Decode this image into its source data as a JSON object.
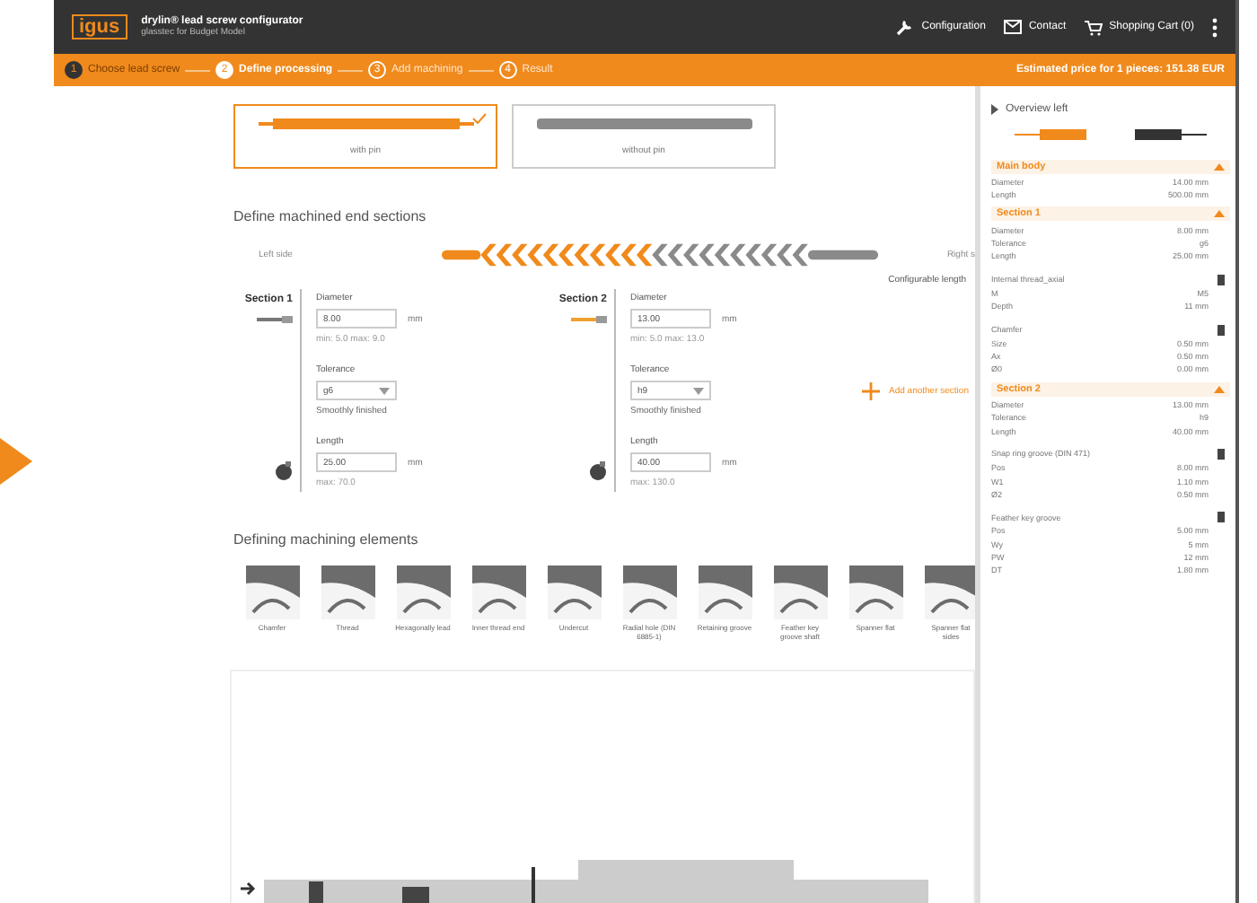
{
  "header": {
    "logo": "igus",
    "title": "drylin® lead screw configurator",
    "subtitle": "glasstec for Budget Model",
    "nav": [
      {
        "label": "Configuration",
        "kind": "wrench"
      },
      {
        "label": "Contact",
        "kind": "mail"
      },
      {
        "label": "Shopping Cart (0)",
        "kind": "cart"
      }
    ]
  },
  "steps": [
    {
      "number": "1",
      "label": "Choose lead screw",
      "completed": true,
      "selected": false
    },
    {
      "number": "2",
      "label": "Define processing",
      "completed": false,
      "selected": true
    },
    {
      "number": "3",
      "label": "Add machining",
      "completed": false,
      "selected": false
    },
    {
      "number": "4",
      "label": "Result",
      "completed": false,
      "selected": false
    }
  ],
  "price": "Estimated price for 1 pieces: 151.38 EUR",
  "variants": [
    {
      "label": "with pin",
      "kind": "pin",
      "selected": true
    },
    {
      "label": "without pin",
      "kind": "plain",
      "selected": false
    }
  ],
  "end_sections": {
    "title": "Define machined end sections",
    "left": "Left side",
    "right": "Right s",
    "length_note": "Configurable length"
  },
  "sections": [
    {
      "title": "Section 1",
      "diameter_label": "Diameter",
      "diameter": "8.00",
      "unit": "mm",
      "diameter_range": "min: 5.0 max: 9.0",
      "tolerance_label": "Tolerance",
      "tolerance": "g6",
      "finish": "Smoothly finished",
      "length_label": "Length",
      "length": "25.00",
      "length_unit": "mm",
      "length_max": "max: 70.0"
    },
    {
      "title": "Section 2",
      "diameter_label": "Diameter",
      "diameter": "13.00",
      "unit": "mm",
      "diameter_range": "min: 5.0 max: 13.0",
      "tolerance_label": "Tolerance",
      "tolerance": "h9",
      "finish": "Smoothly finished",
      "length_label": "Length",
      "length": "40.00",
      "length_unit": "mm",
      "length_max": "max: 130.0"
    }
  ],
  "add_section": "Add another section",
  "machining": {
    "title": "Defining machining elements",
    "items": [
      "Chamfer",
      "Thread",
      "Hexagonally lead",
      "Inner thread end",
      "Undercut",
      "Radial hole (DIN 6885-1)",
      "Retaining groove",
      "Feather key groove shaft",
      "Spanner flat",
      "Spanner flat sides"
    ]
  },
  "overview": {
    "title": "Overview left",
    "groups": [
      {
        "title": "Main body",
        "kind": "header",
        "rows": [
          [
            "Diameter",
            "14.00 mm"
          ],
          [
            "Length",
            "500.00 mm"
          ]
        ]
      },
      {
        "title": "Section 1",
        "kind": "header",
        "rows": [
          [
            "Diameter",
            "8.00 mm"
          ],
          [
            "Tolerance",
            "g6"
          ],
          [
            "Length",
            "25.00 mm"
          ]
        ]
      },
      {
        "title": "Internal thread_axial",
        "kind": "element",
        "rows": [
          [
            "M",
            "M5"
          ],
          [
            "Depth",
            "11 mm"
          ]
        ]
      },
      {
        "title": "Chamfer",
        "kind": "element",
        "rows": [
          [
            "Size",
            "0.50 mm"
          ],
          [
            "Ax",
            "0.50 mm"
          ],
          [
            "Ø0",
            "0.00 mm"
          ]
        ]
      },
      {
        "title": "Section 2",
        "kind": "header",
        "rows": [
          [
            "Diameter",
            "13.00 mm"
          ],
          [
            "Tolerance",
            "h9"
          ],
          [
            "Length",
            "40.00 mm"
          ]
        ]
      },
      {
        "title": "Snap ring groove (DIN 471)",
        "kind": "element",
        "rows": [
          [
            "Pos",
            "8.00 mm"
          ],
          [
            "W1",
            "1.10 mm"
          ],
          [
            "Ø2",
            "0.50 mm"
          ]
        ]
      },
      {
        "title": "Feather key groove",
        "kind": "element",
        "rows": [
          [
            "Pos",
            "5.00 mm"
          ],
          [
            "Wy",
            "5 mm"
          ],
          [
            "PW",
            "12 mm"
          ],
          [
            "DT",
            "1.80 mm"
          ]
        ]
      }
    ]
  }
}
